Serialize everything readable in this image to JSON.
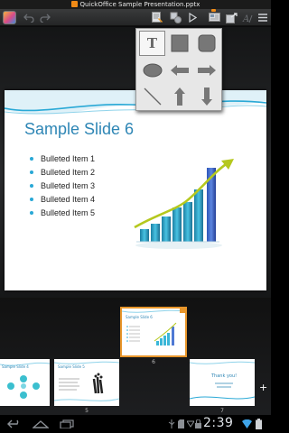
{
  "window": {
    "title": "QuickOffice Sample Presentation.pptx"
  },
  "toolbar": {
    "buttons": [
      {
        "name": "undo-button",
        "icon": "undo-icon"
      },
      {
        "name": "redo-button",
        "icon": "redo-icon"
      },
      {
        "name": "insert-text-button",
        "icon": "text-insert-icon"
      },
      {
        "name": "insert-shape-button",
        "icon": "shapes-icon"
      },
      {
        "name": "play-button",
        "icon": "play-icon"
      },
      {
        "name": "slide-layout-button",
        "icon": "slide-layout-icon"
      },
      {
        "name": "slide-transition-button",
        "icon": "slide-transition-icon"
      },
      {
        "name": "format-button",
        "icon": "font-format-icon"
      },
      {
        "name": "menu-button",
        "icon": "menu-icon"
      }
    ]
  },
  "shape_menu": {
    "shapes": [
      "text-box",
      "square",
      "rounded-rectangle",
      "ellipse",
      "left-arrow",
      "right-arrow",
      "line",
      "up-arrow",
      "down-arrow"
    ],
    "text_box_glyph": "T"
  },
  "slide": {
    "title": "Sample Slide 6",
    "bullets": [
      "Bulleted Item 1",
      "Bulleted Item 2",
      "Bulleted Item 3",
      "Bulleted Item 4",
      "Bulleted Item 5"
    ],
    "accent_color": "#2e86b5"
  },
  "thumbnails": [
    {
      "number": "",
      "title": "Sample Slide 4"
    },
    {
      "number": "5",
      "title": "Sample Slide 5"
    },
    {
      "number": "6",
      "title": "Sample Slide 6",
      "selected": true
    },
    {
      "number": "7",
      "title": "Thank you!"
    }
  ],
  "add_slide_label": "+",
  "system_bar": {
    "clock": "2:39"
  }
}
